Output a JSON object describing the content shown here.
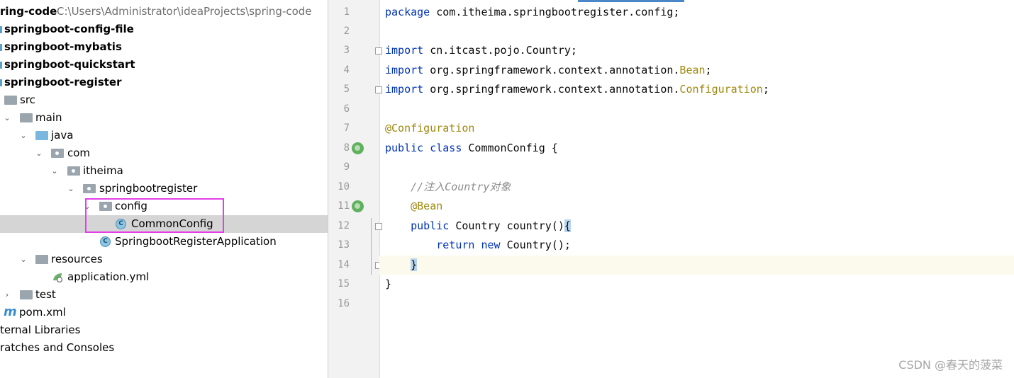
{
  "project_tree": {
    "root": {
      "label": "ring-code",
      "path": "C:\\Users\\Administrator\\ideaProjects\\spring-code"
    },
    "modules": [
      "springboot-config-file",
      "springboot-mybatis",
      "springboot-quickstart",
      "springboot-register"
    ],
    "nodes": {
      "src": "src",
      "main": "main",
      "java": "java",
      "com": "com",
      "itheima": "itheima",
      "springbootregister": "springbootregister",
      "config": "config",
      "common_config": "CommonConfig",
      "application": "SpringbootRegisterApplication",
      "resources": "resources",
      "application_yml": "application.yml",
      "test": "test",
      "pom": "pom.xml",
      "external_libraries": "ternal Libraries",
      "scratches": "ratches and Consoles"
    },
    "class_icon_letter": "C",
    "maven_icon_letter": "m"
  },
  "editor": {
    "line_numbers": [
      "1",
      "2",
      "3",
      "4",
      "5",
      "6",
      "7",
      "8",
      "9",
      "10",
      "11",
      "12",
      "13",
      "14",
      "15",
      "16"
    ],
    "code": {
      "l1_kw": "package",
      "l1_rest": " com.itheima.springbootregister.config;",
      "l3_kw": "import",
      "l3_rest": " cn.itcast.pojo.Country;",
      "l4_kw": "import",
      "l4_rest": " org.springframework.context.annotation.",
      "l4_type": "Bean",
      "l4_end": ";",
      "l5_kw": "import",
      "l5_rest": " org.springframework.context.annotation.",
      "l5_type": "Configuration",
      "l5_end": ";",
      "l7_ann": "@Configuration",
      "l8_kw": "public class",
      "l8_rest": " CommonConfig {",
      "l10_cmt": "    //注入Country对象",
      "l11_ann": "    @Bean",
      "l12_indent": "    ",
      "l12_kw": "public",
      "l12_rest": " Country country()",
      "l12_brace": "{",
      "l13_indent": "        ",
      "l13_kw1": "return",
      "l13_sp": " ",
      "l13_kw2": "new",
      "l13_rest": " Country();",
      "l14_indent": "    ",
      "l14_brace": "}",
      "l15": "}"
    }
  },
  "watermark": "CSDN @春天的菠菜",
  "colors": {
    "keyword": "#0033b3",
    "annotation": "#9e880d",
    "comment": "#8c8c8c",
    "highlight_box": "#e43ee8",
    "selection": "#d5d5d5",
    "current_line": "#fcfaed"
  }
}
